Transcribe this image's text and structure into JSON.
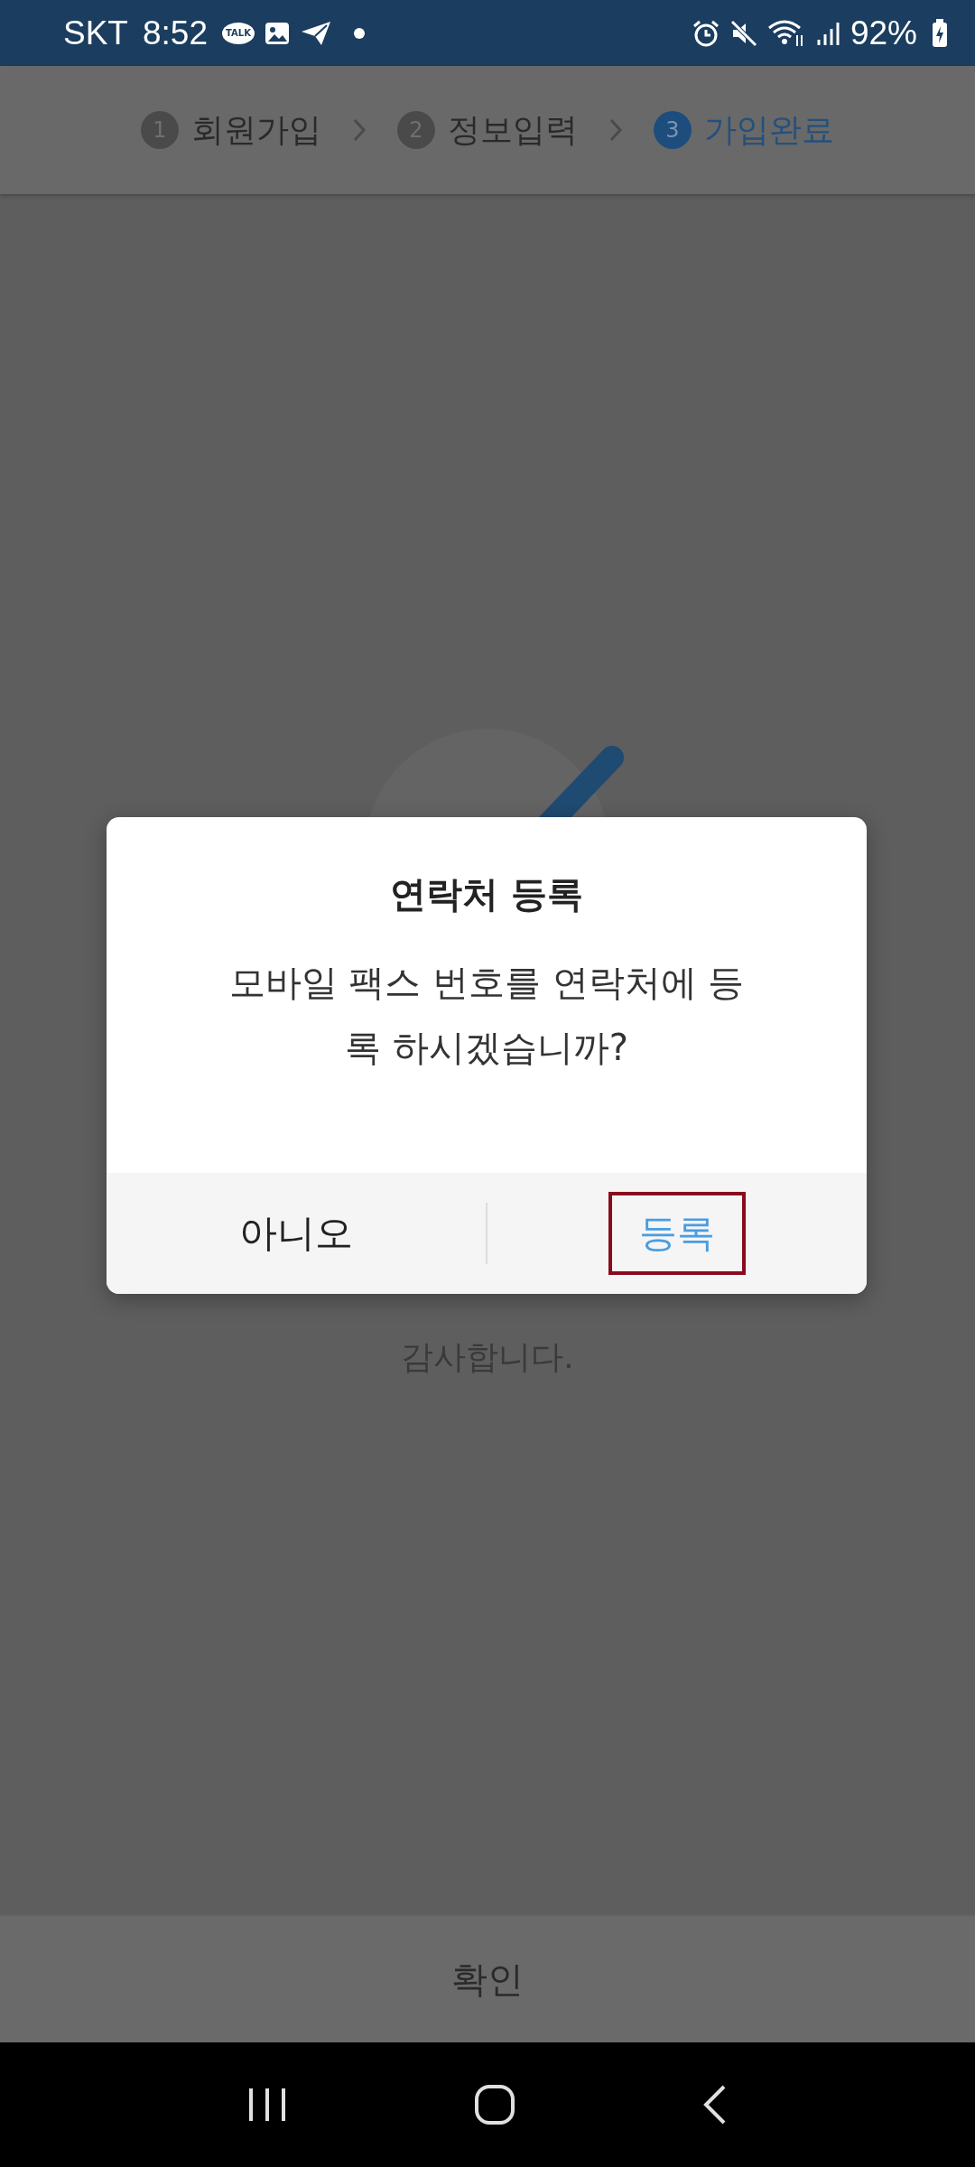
{
  "status_bar": {
    "carrier": "SKT",
    "time": "8:52",
    "talk_badge": "TALK",
    "battery": "92%"
  },
  "steps": [
    {
      "number": "1",
      "label": "회원가입",
      "selected": false
    },
    {
      "number": "2",
      "label": "정보입력",
      "selected": false
    },
    {
      "number": "3",
      "label": "가입완료",
      "selected": true
    }
  ],
  "message": [
    "감사합니다."
  ],
  "confirm_button": "확인",
  "dialog": {
    "title": "연락처 등록",
    "message_lines": [
      "모바일 팩스 번호를 연락처에 등",
      "록 하시겠습니까?"
    ],
    "buttons": [
      {
        "label": "아니오",
        "kind": "cancel",
        "focused": false
      },
      {
        "label": "등록",
        "kind": "confirm",
        "focused": true
      }
    ]
  }
}
